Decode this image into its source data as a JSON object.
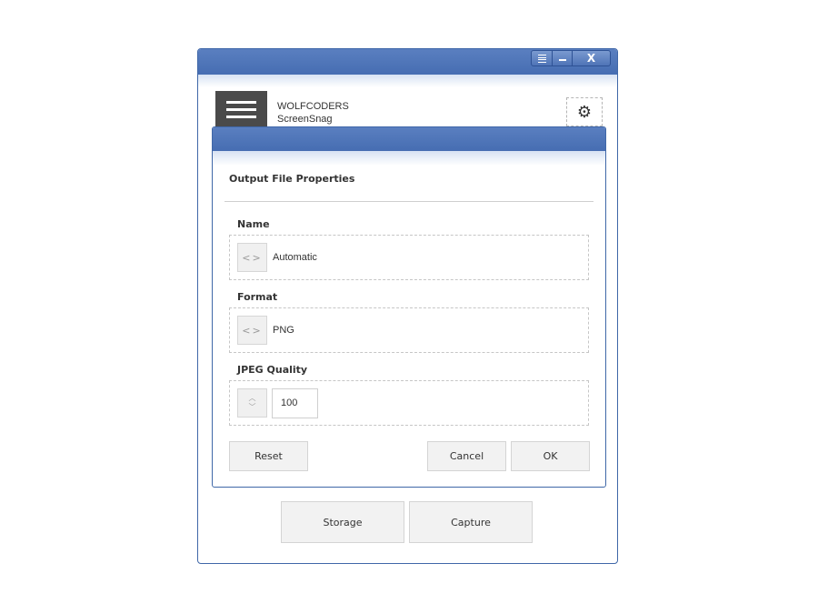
{
  "window": {
    "controls": {
      "menu_icon": "menu-icon",
      "minimize_icon": "minimize-icon",
      "close_glyph": "X"
    }
  },
  "header": {
    "brand_line1": "WOLFCODERS",
    "brand_line2": "ScreenSnag",
    "settings_icon": "⚙"
  },
  "dialog": {
    "heading": "Output File Properties",
    "fields": {
      "name": {
        "label": "Name",
        "value": "Automatic",
        "selector_glyph": "<>"
      },
      "format": {
        "label": "Format",
        "value": "PNG",
        "selector_glyph": "<>"
      },
      "jpeg_quality": {
        "label": "JPEG Quality",
        "value": "100",
        "up_glyph": "︿",
        "down_glyph": "﹀"
      }
    },
    "buttons": {
      "reset": "Reset",
      "cancel": "Cancel",
      "ok": "OK"
    }
  },
  "footer": {
    "storage": "Storage",
    "capture": "Capture"
  },
  "colors": {
    "titlebar": "#466db2",
    "accent_border": "#3f67a8"
  }
}
